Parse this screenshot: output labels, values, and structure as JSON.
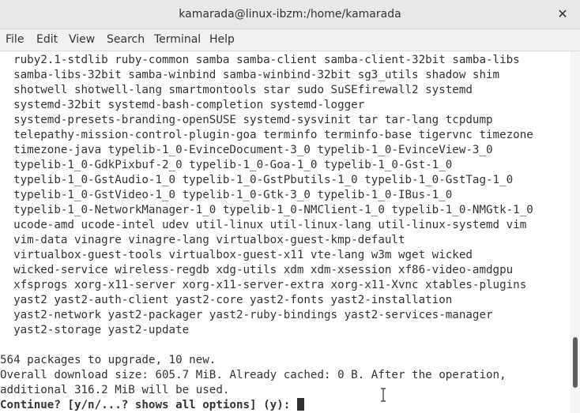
{
  "window": {
    "title": "kamarada@linux-ibzm:/home/kamarada",
    "close_icon": "close-icon",
    "close_glyph": "✕"
  },
  "menubar": {
    "items": [
      "File",
      "Edit",
      "View",
      "Search",
      "Terminal",
      "Help"
    ]
  },
  "terminal": {
    "package_lines": [
      "  ruby2.1-stdlib ruby-common samba samba-client samba-client-32bit samba-libs",
      "  samba-libs-32bit samba-winbind samba-winbind-32bit sg3_utils shadow shim",
      "  shotwell shotwell-lang smartmontools star sudo SuSEfirewall2 systemd",
      "  systemd-32bit systemd-bash-completion systemd-logger",
      "  systemd-presets-branding-openSUSE systemd-sysvinit tar tar-lang tcpdump",
      "  telepathy-mission-control-plugin-goa terminfo terminfo-base tigervnc timezone",
      "  timezone-java typelib-1_0-EvinceDocument-3_0 typelib-1_0-EvinceView-3_0",
      "  typelib-1_0-GdkPixbuf-2_0 typelib-1_0-Goa-1_0 typelib-1_0-Gst-1_0",
      "  typelib-1_0-GstAudio-1_0 typelib-1_0-GstPbutils-1_0 typelib-1_0-GstTag-1_0",
      "  typelib-1_0-GstVideo-1_0 typelib-1_0-Gtk-3_0 typelib-1_0-IBus-1_0",
      "  typelib-1_0-NetworkManager-1_0 typelib-1_0-NMClient-1_0 typelib-1_0-NMGtk-1_0",
      "  ucode-amd ucode-intel udev util-linux util-linux-lang util-linux-systemd vim",
      "  vim-data vinagre vinagre-lang virtualbox-guest-kmp-default",
      "  virtualbox-guest-tools virtualbox-guest-x11 vte-lang w3m wget wicked",
      "  wicked-service wireless-regdb xdg-utils xdm xdm-xsession xf86-video-amdgpu",
      "  xfsprogs xorg-x11-server xorg-x11-server-extra xorg-x11-Xvnc xtables-plugins",
      "  yast2 yast2-auth-client yast2-core yast2-fonts yast2-installation",
      "  yast2-network yast2-packager yast2-ruby-bindings yast2-services-manager",
      "  yast2-storage yast2-update"
    ],
    "summary_line": "564 packages to upgrade, 10 new.",
    "download_line_1": "Overall download size: 605.7 MiB. Already cached: 0 B. After the operation,",
    "download_line_2": "additional 316.2 MiB will be used.",
    "prompt": "Continue? [y/n/...? shows all options] (y): "
  },
  "scrollbar": {
    "thumb_position_fraction": 0.86,
    "thumb_size_fraction": 0.14
  }
}
